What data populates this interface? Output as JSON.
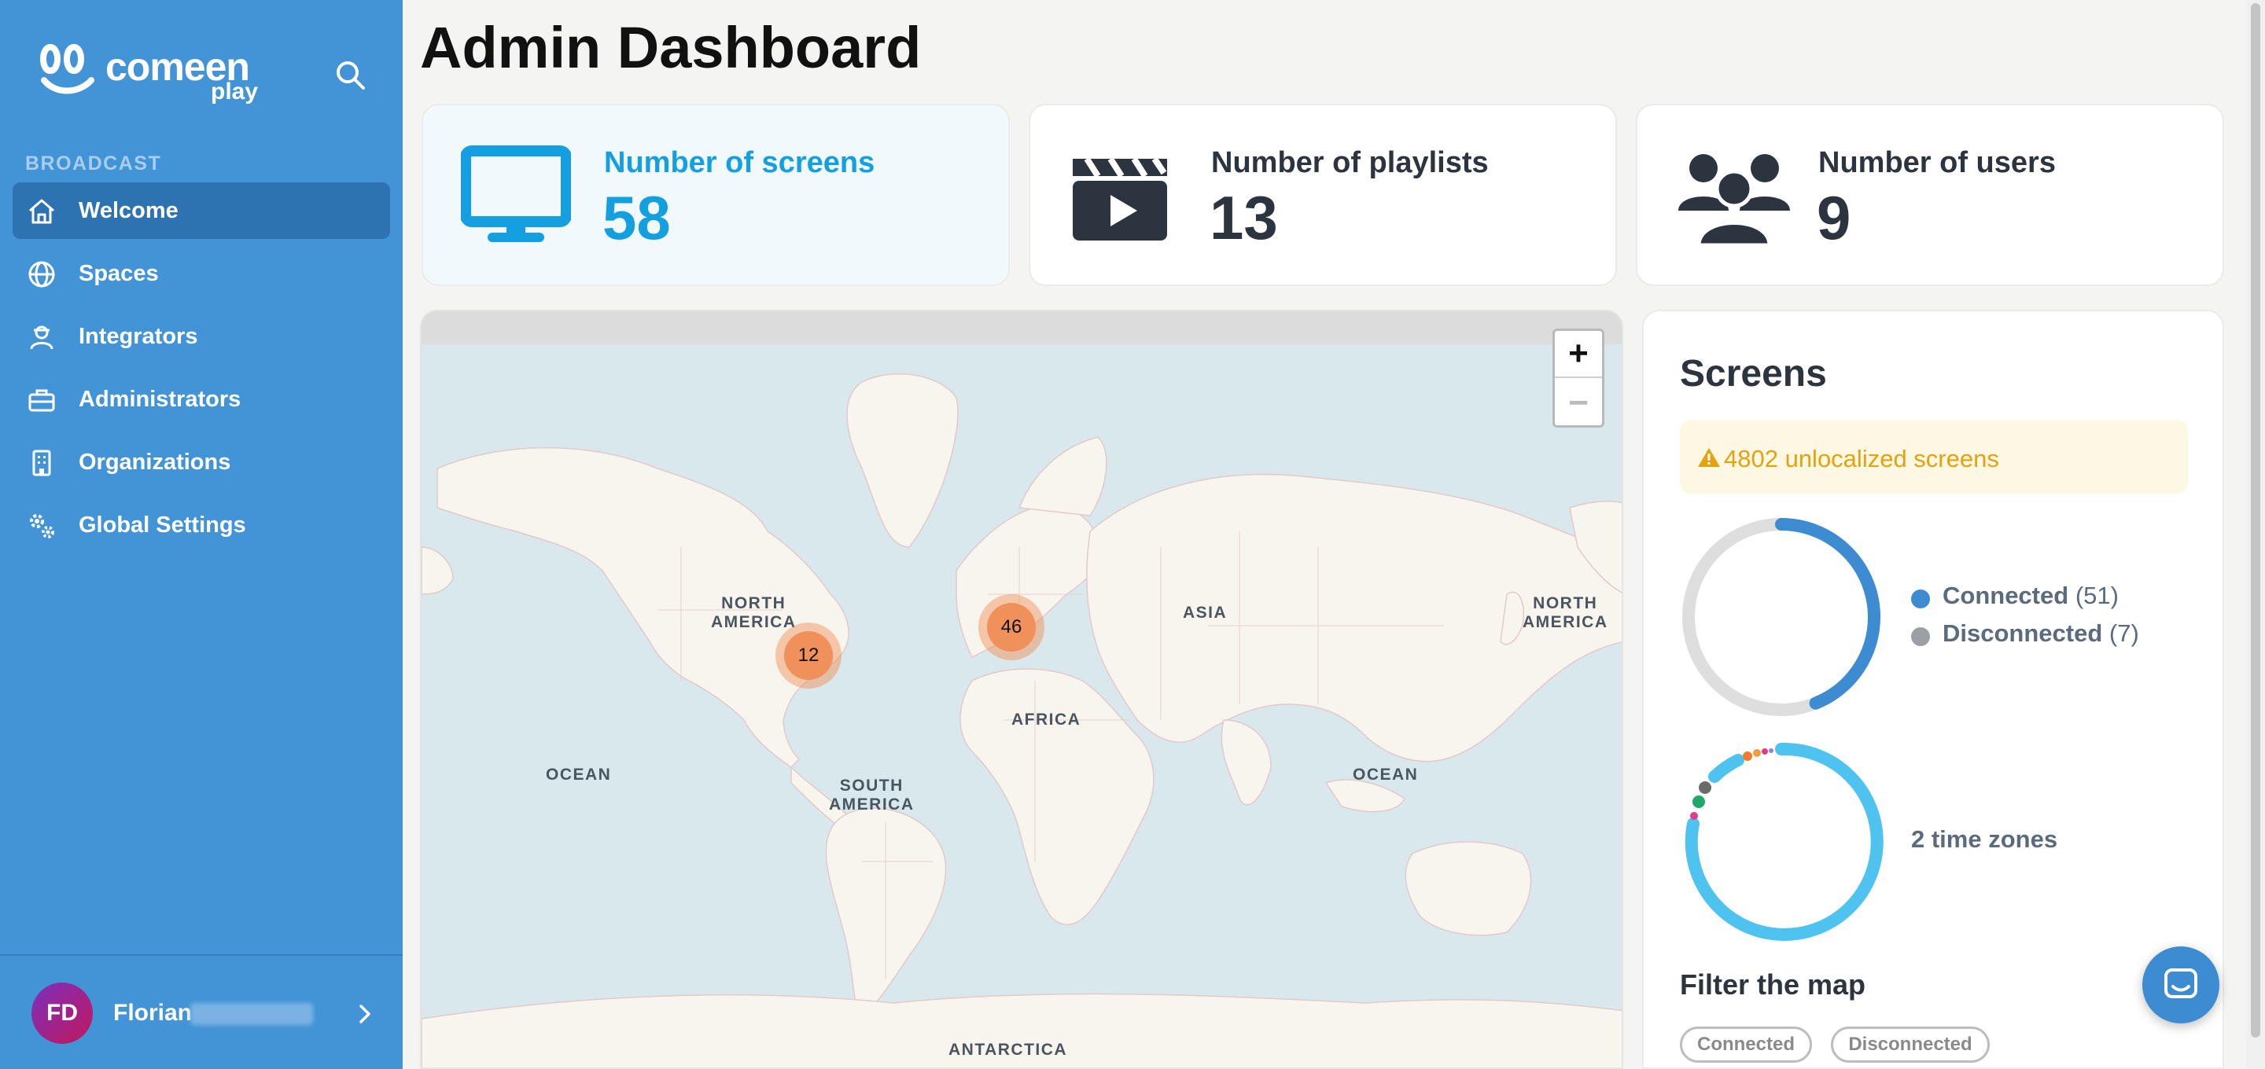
{
  "sidebar": {
    "brand": "comeen",
    "brand_sub": "play",
    "section": "BROADCAST",
    "items": [
      {
        "label": "Welcome",
        "icon": "home-icon",
        "active": true
      },
      {
        "label": "Spaces",
        "icon": "globe-icon"
      },
      {
        "label": "Integrators",
        "icon": "integrator-icon"
      },
      {
        "label": "Administrators",
        "icon": "toolbox-icon"
      },
      {
        "label": "Organizations",
        "icon": "building-icon"
      },
      {
        "label": "Global Settings",
        "icon": "gears-icon"
      }
    ],
    "user": {
      "initials": "FD",
      "first_name": "Florian"
    }
  },
  "page": {
    "title": "Admin Dashboard"
  },
  "stats": [
    {
      "label": "Number of screens",
      "value": "58",
      "icon": "monitor-icon"
    },
    {
      "label": "Number of playlists",
      "value": "13",
      "icon": "clapperboard-icon"
    },
    {
      "label": "Number of users",
      "value": "9",
      "icon": "users-icon"
    }
  ],
  "map": {
    "zoom_in": "+",
    "zoom_out": "−",
    "labels": {
      "north_america_left": "NORTH\nAMERICA",
      "north_america_right": "NORTH\nAMERICA",
      "asia": "ASIA",
      "africa": "AFRICA",
      "south_america": "SOUTH\nAMERICA",
      "ocean_left": "OCEAN",
      "ocean_right": "OCEAN",
      "antarctica": "ANTARCTICA"
    },
    "clusters": [
      {
        "count": "12",
        "region": "north-america"
      },
      {
        "count": "46",
        "region": "europe"
      }
    ]
  },
  "screens_panel": {
    "title": "Screens",
    "alert": "4802 unlocalized screens",
    "connected": {
      "label": "Connected",
      "count": "(51)",
      "value": 51,
      "color": "#3d8bd0"
    },
    "disconnected": {
      "label": "Disconnected",
      "count": "(7)",
      "value": 7,
      "color": "#9aa0a6"
    },
    "timezones_label": "2 time zones",
    "filter_heading": "Filter the map",
    "filters": [
      "Connected",
      "Disconnected"
    ]
  },
  "colors": {
    "sidebar": "#4294d6",
    "accent": "#139fe0",
    "alert": "#e5a20c",
    "cluster": "#f0905a",
    "timezone_ring": "#4fc3f0"
  }
}
